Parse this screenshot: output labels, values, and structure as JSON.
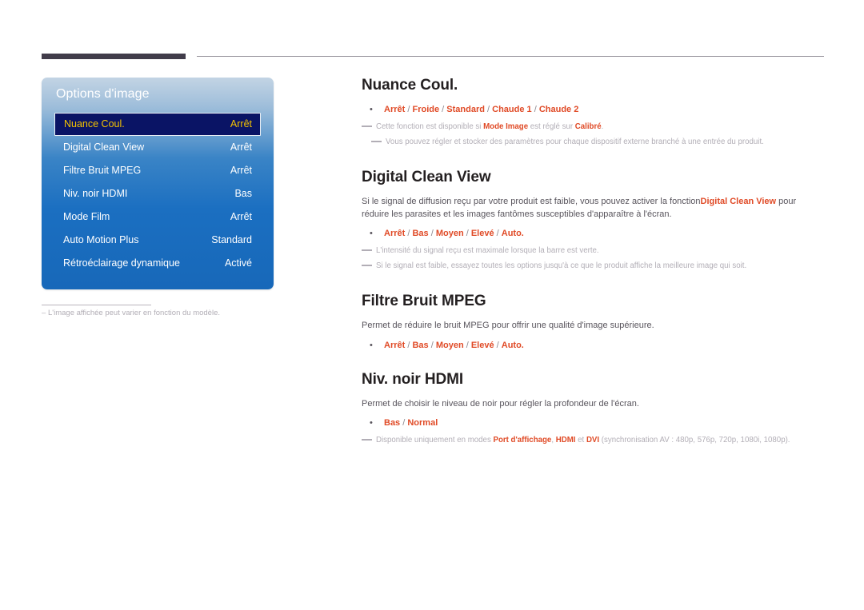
{
  "osd": {
    "title": "Options d'image",
    "rows": [
      {
        "label": "Nuance Coul.",
        "value": "Arrêt",
        "selected": true
      },
      {
        "label": "Digital Clean View",
        "value": "Arrêt",
        "selected": false
      },
      {
        "label": "Filtre Bruit MPEG",
        "value": "Arrêt",
        "selected": false
      },
      {
        "label": "Niv. noir HDMI",
        "value": "Bas",
        "selected": false
      },
      {
        "label": "Mode Film",
        "value": "Arrêt",
        "selected": false
      },
      {
        "label": "Auto Motion Plus",
        "value": "Standard",
        "selected": false
      },
      {
        "label": "Rétroéclairage dynamique",
        "value": "Activé",
        "selected": false
      }
    ]
  },
  "left_note": "L'image affichée peut varier en fonction du modèle.",
  "sections": {
    "nuance": {
      "title": "Nuance Coul.",
      "options": {
        "o1": "Arrêt",
        "s1": " / ",
        "o2": "Froide",
        "s2": " / ",
        "o3": "Standard",
        "s3": " / ",
        "o4": "Chaude 1",
        "s4": " / ",
        "o5": "Chaude 2"
      },
      "fn1_a": "Cette fonction est disponible si ",
      "fn1_b": "Mode Image",
      "fn1_c": " est réglé sur ",
      "fn1_d": "Calibré",
      "fn1_e": ".",
      "fn2": "Vous pouvez régler et stocker des paramètres pour chaque dispositif externe branché à une entrée du produit."
    },
    "dcv": {
      "title": "Digital Clean View",
      "body_a": "Si le signal de diffusion reçu par votre produit est faible, vous pouvez activer la fonction",
      "body_b": "Digital Clean View",
      "body_c": " pour réduire les parasites et les images fantômes susceptibles d'apparaître à l'écran.",
      "options": {
        "o1": "Arrêt",
        "s1": " / ",
        "o2": "Bas",
        "s2": " / ",
        "o3": "Moyen",
        "s3": " / ",
        "o4": "Elevé",
        "s4": " / ",
        "o5": "Auto."
      },
      "fn1": "L'intensité du signal reçu est maximale lorsque la barre est verte.",
      "fn2": "Si le signal est faible, essayez toutes les options jusqu'à ce que le produit affiche la meilleure image qui soit."
    },
    "mpeg": {
      "title": "Filtre Bruit MPEG",
      "body": "Permet de réduire le bruit MPEG pour offrir une qualité d'image supérieure.",
      "options": {
        "o1": "Arrêt",
        "s1": " / ",
        "o2": "Bas",
        "s2": " / ",
        "o3": "Moyen",
        "s3": " / ",
        "o4": "Elevé",
        "s4": " / ",
        "o5": "Auto."
      }
    },
    "hdmi": {
      "title": "Niv. noir HDMI",
      "body": "Permet de choisir le niveau de noir pour régler la profondeur de l'écran.",
      "options": {
        "o1": "Bas",
        "s1": " / ",
        "o2": "Normal"
      },
      "fn1_a": "Disponible uniquement en modes ",
      "fn1_b": "Port d'affichage",
      "fn1_c": ", ",
      "fn1_d": "HDMI",
      "fn1_e": " et ",
      "fn1_f": "DVI",
      "fn1_g": " (synchronisation AV : 480p, 576p, 720p, 1080i, 1080p)."
    }
  },
  "colors": {
    "accent_orange": "#e04a26",
    "osd_blue": "#1b6fc1",
    "osd_selected_navy": "#0a1465",
    "osd_selected_text": "#f5c400",
    "rule_dark": "#413c4a"
  }
}
